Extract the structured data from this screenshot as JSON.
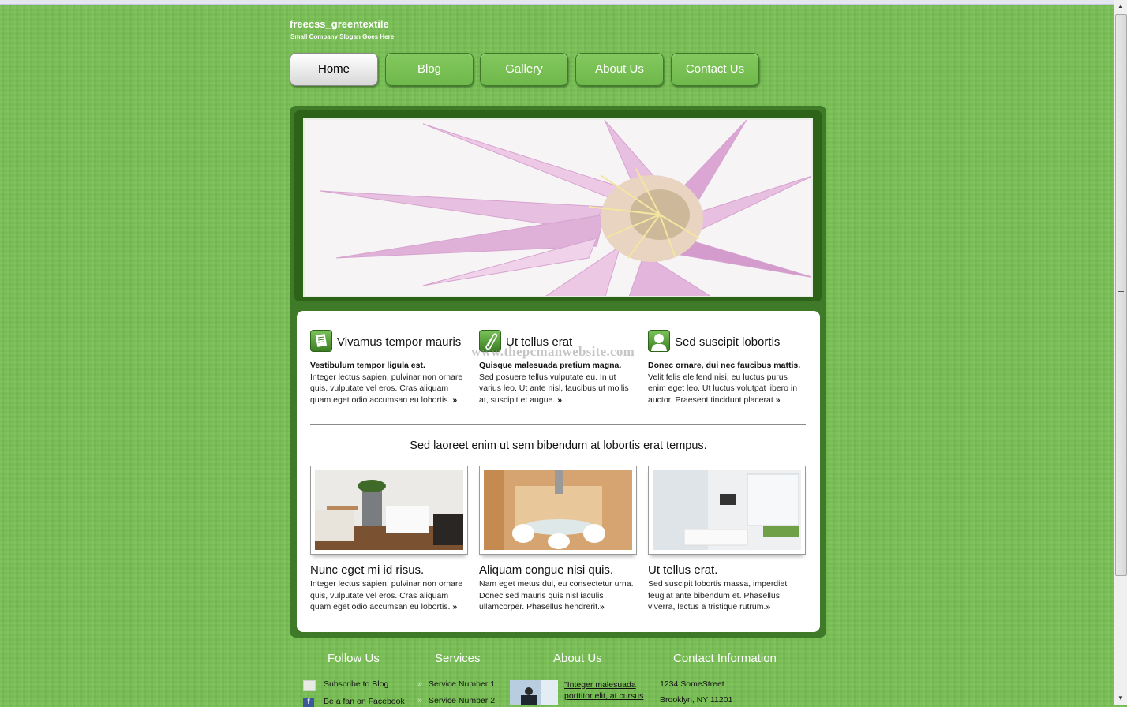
{
  "site": {
    "title": "freecss_greentextile",
    "slogan": "Small Company Slogan Goes Here"
  },
  "nav": {
    "items": [
      {
        "label": "Home",
        "active": true
      },
      {
        "label": "Blog",
        "active": false
      },
      {
        "label": "Gallery",
        "active": false
      },
      {
        "label": "About Us",
        "active": false
      },
      {
        "label": "Contact Us",
        "active": false
      }
    ]
  },
  "banner": {
    "alt": "pink cactus flower with water droplets",
    "icon": "flower-image"
  },
  "features": [
    {
      "icon": "document-icon",
      "title": "Vivamus tempor mauris",
      "lead": "Vestibulum tempor ligula est.",
      "text": "Integer lectus sapien, pulvinar non ornare quis, vulputate vel eros. Cras aliquam quam eget odio accumsan eu lobortis.",
      "more": "»"
    },
    {
      "icon": "paperclip-icon",
      "title": "Ut tellus erat",
      "lead": "Quisque malesuada pretium magna.",
      "text": "Sed posuere tellus vulputate eu. In ut varius leo. Ut ante nisl, faucibus ut mollis at, suscipit et augue.",
      "more": "»"
    },
    {
      "icon": "user-icon",
      "title": "Sed suscipit lobortis",
      "lead": "Donec ornare, dui nec faucibus mattis.",
      "text": "Velit felis eleifend nisi, eu luctus purus enim eget leo. Ut luctus volutpat libero in auctor. Praesent tincidunt placerat.",
      "more": "»"
    }
  ],
  "watermark": "www.thepcmanwebsite.com",
  "tagline": "Sed laoreet enim ut sem bibendum at lobortis erat tempus.",
  "gallery": [
    {
      "title": "Nunc eget mi id risus.",
      "text": "Integer lectus sapien, pulvinar non ornare quis, vulputate vel eros. Cras aliquam quam eget odio accumsan eu lobortis.",
      "more": "»"
    },
    {
      "title": "Aliquam congue nisi quis.",
      "text": "Nam eget metus dui, eu consectetur urna. Donec sed mauris quis nisl iaculis ullamcorper. Phasellus hendrerit.",
      "more": "»"
    },
    {
      "title": "Ut tellus erat.",
      "text": "Sed suscipit lobortis massa, imperdiet feugiat ante bibendum et. Phasellus viverra, lectus a tristique rutrum.",
      "more": "»"
    }
  ],
  "footer": {
    "follow": {
      "heading": "Follow Us",
      "items": [
        {
          "icon": "mail-icon",
          "label": "Subscribe to Blog"
        },
        {
          "icon": "facebook-icon",
          "label": "Be a fan on Facebook"
        }
      ]
    },
    "services": {
      "heading": "Services",
      "items": [
        {
          "label": "Service Number 1"
        },
        {
          "label": "Service Number 2"
        }
      ]
    },
    "about": {
      "heading": "About Us",
      "quote_line1": "\"Integer malesuada",
      "quote_line2": "porttitor elit, at cursus"
    },
    "contact": {
      "heading": "Contact Information",
      "street": "1234 SomeStreet",
      "city": "Brooklyn, NY 11201"
    }
  }
}
